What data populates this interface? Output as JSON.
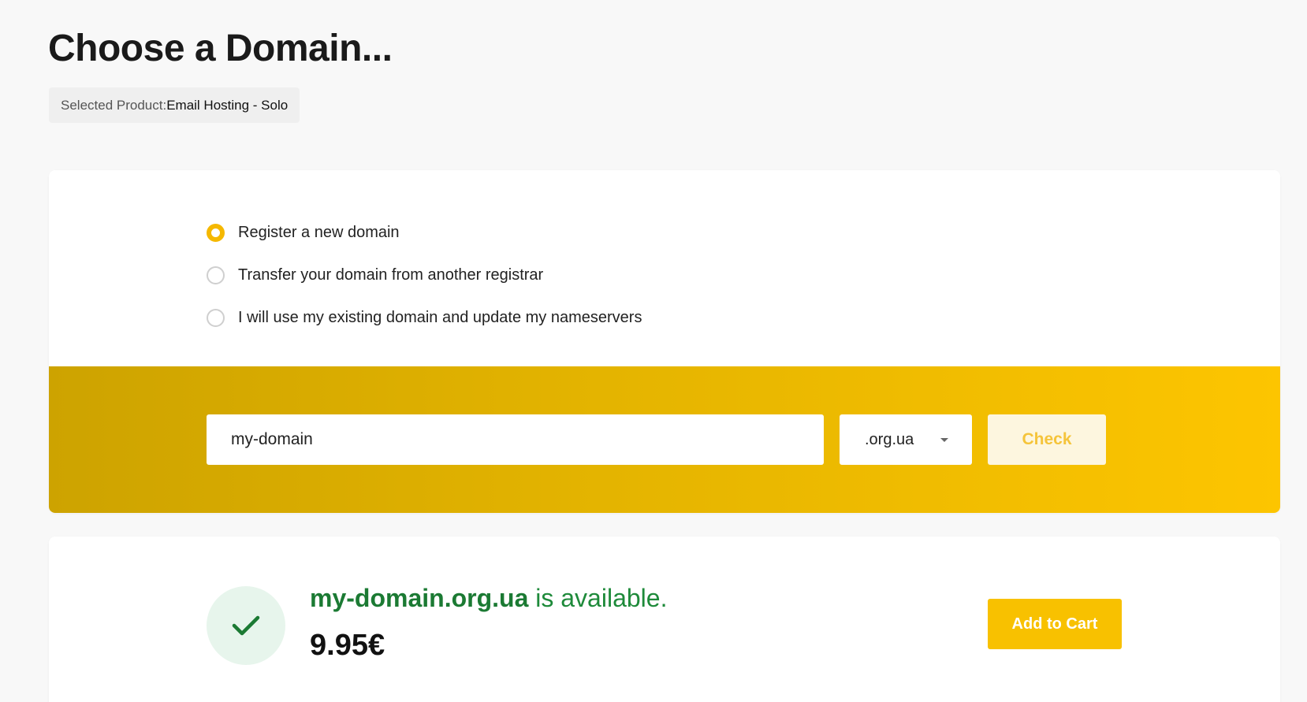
{
  "page": {
    "title": "Choose a Domain..."
  },
  "selected_product": {
    "label": "Selected Product:",
    "value": "Email Hosting - Solo"
  },
  "domain_options": [
    {
      "label": "Register a new domain",
      "selected": true
    },
    {
      "label": "Transfer your domain from another registrar",
      "selected": false
    },
    {
      "label": "I will use my existing domain and update my nameservers",
      "selected": false
    }
  ],
  "search": {
    "domain_value": "my-domain",
    "tld_selected": ".org.ua",
    "check_label": "Check"
  },
  "result": {
    "domain": "my-domain.org.ua",
    "status_text": " is available.",
    "price": "9.95€",
    "add_to_cart_label": "Add to Cart",
    "icon": "checkmark-icon"
  },
  "colors": {
    "accent": "#f8c100",
    "success": "#1b7a33",
    "success_bg": "#e7f5ec"
  }
}
